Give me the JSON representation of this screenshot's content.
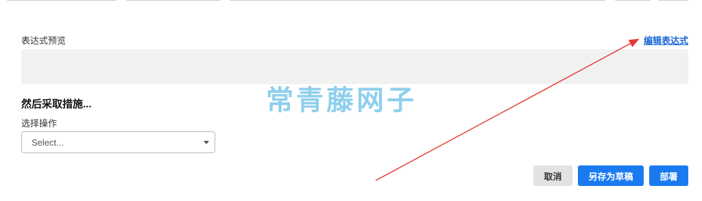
{
  "expression_preview": {
    "label": "表达式预览",
    "edit_link": "编辑表达式",
    "content": ""
  },
  "action_section": {
    "heading": "然后采取措施...",
    "operation_label": "选择操作",
    "select_value": "Select..."
  },
  "watermark": {
    "text": "常青藤网子"
  },
  "footer": {
    "cancel_label": "取消",
    "save_draft_label": "另存为草稿",
    "deploy_label": "部署"
  },
  "colors": {
    "primary": "#1a7bf0",
    "link": "#1a66d6",
    "annotation_arrow": "#e53935",
    "watermark": "#7cc7ea"
  }
}
